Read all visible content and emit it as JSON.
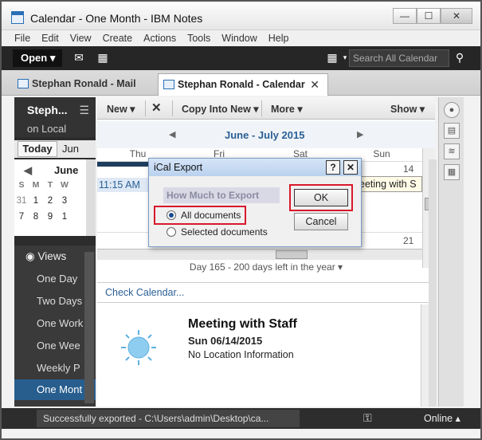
{
  "window": {
    "title": "Calendar - One Month - IBM Notes",
    "min_glyph": "—",
    "max_glyph": "☐",
    "close_glyph": "✕"
  },
  "menubar": [
    "File",
    "Edit",
    "View",
    "Create",
    "Actions",
    "Tools",
    "Window",
    "Help"
  ],
  "toolbar": {
    "open_label": "Open ▾",
    "search_placeholder": "Search All Calendar"
  },
  "tabs": [
    {
      "label": "Stephan Ronald - Mail"
    },
    {
      "label": "Stephan Ronald - Calendar",
      "close": "✕"
    }
  ],
  "account": {
    "name": "Steph...",
    "location": "on Local"
  },
  "nav": {
    "today_label": "Today",
    "today_month_short": "Jun"
  },
  "minical": {
    "month": "June",
    "dow": [
      "S",
      "M",
      "T",
      "W"
    ],
    "row1": [
      "31",
      "1",
      "2",
      "3"
    ],
    "row2": [
      "7",
      "8",
      "9",
      "1"
    ]
  },
  "views": {
    "header": "Views",
    "items": [
      "One Day",
      "Two Days",
      "One Work",
      "One Wee",
      "Weekly P",
      "One Mont"
    ]
  },
  "actions": {
    "new": "New ▾",
    "copy_into_new": "Copy Into New ▾",
    "more": "More ▾",
    "show": "Show ▾"
  },
  "calendar": {
    "month_title": "June - July 2015",
    "days": [
      "Thu",
      "Fri",
      "Sat",
      "Sun"
    ],
    "date_14": "14",
    "date_21": "21",
    "event_left": "11:15 AM",
    "event_right": "eeting with S",
    "day_status": "Day 165 - 200 days left in the year ▾",
    "check_calendar": "Check Calendar..."
  },
  "preview": {
    "title": "Meeting with Staff",
    "date": "Sun 06/14/2015",
    "location": "No Location Information"
  },
  "dialog": {
    "title": "iCal Export",
    "help": "?",
    "close": "✕",
    "group_label": "How Much to Export",
    "option_all": "All documents",
    "option_selected": "Selected documents",
    "ok": "OK",
    "cancel": "Cancel"
  },
  "status": {
    "message": "Successfully exported - C:\\Users\\admin\\Desktop\\ca...",
    "online": "Online ▴"
  },
  "colors": {
    "highlight": "#d8182b",
    "accent": "#2a5f96"
  }
}
